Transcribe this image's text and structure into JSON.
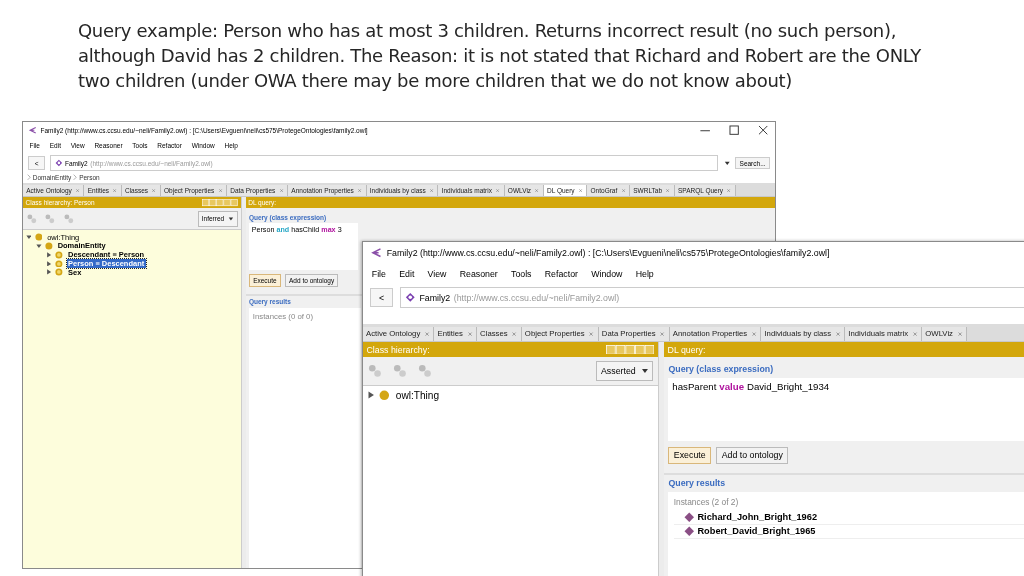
{
  "slide": {
    "heading": "Query example: Person who has at most 3 children. Returns incorrect result (no such person), although David has 2 children. The Reason: it is not stated that Richard and Robert are the ONLY two children (under OWA there may be more children that we do not know about)"
  },
  "windows": [
    {
      "title": "Family2 (http://www.cs.ccsu.edu/~neli/Family2.owl) : [C:\\Users\\Evgueni\\neli\\cs575\\ProtegeOntologies\\family2.owl]",
      "window_controls": true,
      "menu": [
        "File",
        "Edit",
        "View",
        "Reasoner",
        "Tools",
        "Refactor",
        "Window",
        "Help"
      ],
      "nav": {
        "back": "<",
        "ontology": "Family2",
        "iri": "(http://www.cs.ccsu.edu/~neli/Family2.owl)",
        "search": "Search..."
      },
      "breadcrumb": [
        "DomainEntity",
        "Person"
      ],
      "tabs": [
        {
          "label": "Active Ontology",
          "selected": false
        },
        {
          "label": "Entities",
          "selected": false
        },
        {
          "label": "Classes",
          "selected": false
        },
        {
          "label": "Object Properties",
          "selected": false
        },
        {
          "label": "Data Properties",
          "selected": false
        },
        {
          "label": "Annotation Properties",
          "selected": false
        },
        {
          "label": "Individuals by class",
          "selected": false
        },
        {
          "label": "Individuals matrix",
          "selected": false
        },
        {
          "label": "OWLViz",
          "selected": false
        },
        {
          "label": "DL Query",
          "selected": true
        },
        {
          "label": "OntoGraf",
          "selected": false
        },
        {
          "label": "SWRLTab",
          "selected": false
        },
        {
          "label": "SPARQL Query",
          "selected": false
        }
      ],
      "class_panel": {
        "title": "Class hierarchy: Person",
        "kind": "inferred",
        "mode": "Inferred",
        "tree": [
          {
            "label": "owl:Thing",
            "bold": false,
            "expanded": true,
            "selected": false,
            "children": [
              {
                "label": "DomainEntity",
                "bold": true,
                "expanded": true,
                "selected": false,
                "children": [
                  {
                    "label": "Descendant ≡ Person",
                    "bold": true,
                    "expanded": false,
                    "selected": false
                  },
                  {
                    "label": "Person ≡ Descendant",
                    "bold": true,
                    "expanded": false,
                    "selected": true
                  },
                  {
                    "label": "Sex",
                    "bold": true,
                    "expanded": false,
                    "selected": false
                  }
                ]
              }
            ]
          }
        ]
      },
      "query_panel": {
        "title": "DL query:",
        "query_label": "Query (class expression)",
        "query": [
          {
            "text": "Person",
            "kind": "name"
          },
          {
            "text": "and",
            "kind": "connective"
          },
          {
            "text": "hasChild",
            "kind": "name"
          },
          {
            "text": "max",
            "kind": "restriction"
          },
          {
            "text": "3",
            "kind": "name"
          }
        ],
        "buttons": [
          "Execute",
          "Add to ontology"
        ],
        "results_label": "Query results",
        "results_count": "Instances (0 of 0)"
      }
    },
    {
      "title": "Family2 (http://www.cs.ccsu.edu/~neli/Family2.owl)  : [C:\\Users\\Evgueni\\neli\\cs575\\ProtegeOntologies\\family2.owl]",
      "window_controls": false,
      "menu": [
        "File",
        "Edit",
        "View",
        "Reasoner",
        "Tools",
        "Refactor",
        "Window",
        "Help"
      ],
      "nav": {
        "back": "<",
        "ontology": "Family2",
        "iri": "(http://www.cs.ccsu.edu/~neli/Family2.owl)"
      },
      "tabs": [
        {
          "label": "Active Ontology",
          "selected": false
        },
        {
          "label": "Entities",
          "selected": false
        },
        {
          "label": "Classes",
          "selected": false
        },
        {
          "label": "Object Properties",
          "selected": false
        },
        {
          "label": "Data Properties",
          "selected": false
        },
        {
          "label": "Annotation Properties",
          "selected": false
        },
        {
          "label": "Individuals by class",
          "selected": false
        },
        {
          "label": "Individuals matrix",
          "selected": false
        },
        {
          "label": "OWLViz",
          "selected": false
        }
      ],
      "class_panel": {
        "title": "Class hierarchy:",
        "kind": "asserted",
        "mode": "Asserted",
        "tree": [
          {
            "label": "owl:Thing",
            "bold": false,
            "expanded": false,
            "selected": false
          }
        ]
      },
      "query_panel": {
        "title": "DL query:",
        "query_label": "Query (class expression)",
        "query": [
          {
            "text": "hasParent",
            "kind": "name"
          },
          {
            "text": "value",
            "kind": "restriction"
          },
          {
            "text": "David_Bright_1934",
            "kind": "name"
          }
        ],
        "buttons": [
          "Execute",
          "Add to ontology"
        ],
        "results_label": "Query results",
        "results_count": "Instances (2 of 2)",
        "results": [
          "Richard_John_Bright_1962",
          "Robert_David_Bright_1965"
        ]
      }
    }
  ]
}
